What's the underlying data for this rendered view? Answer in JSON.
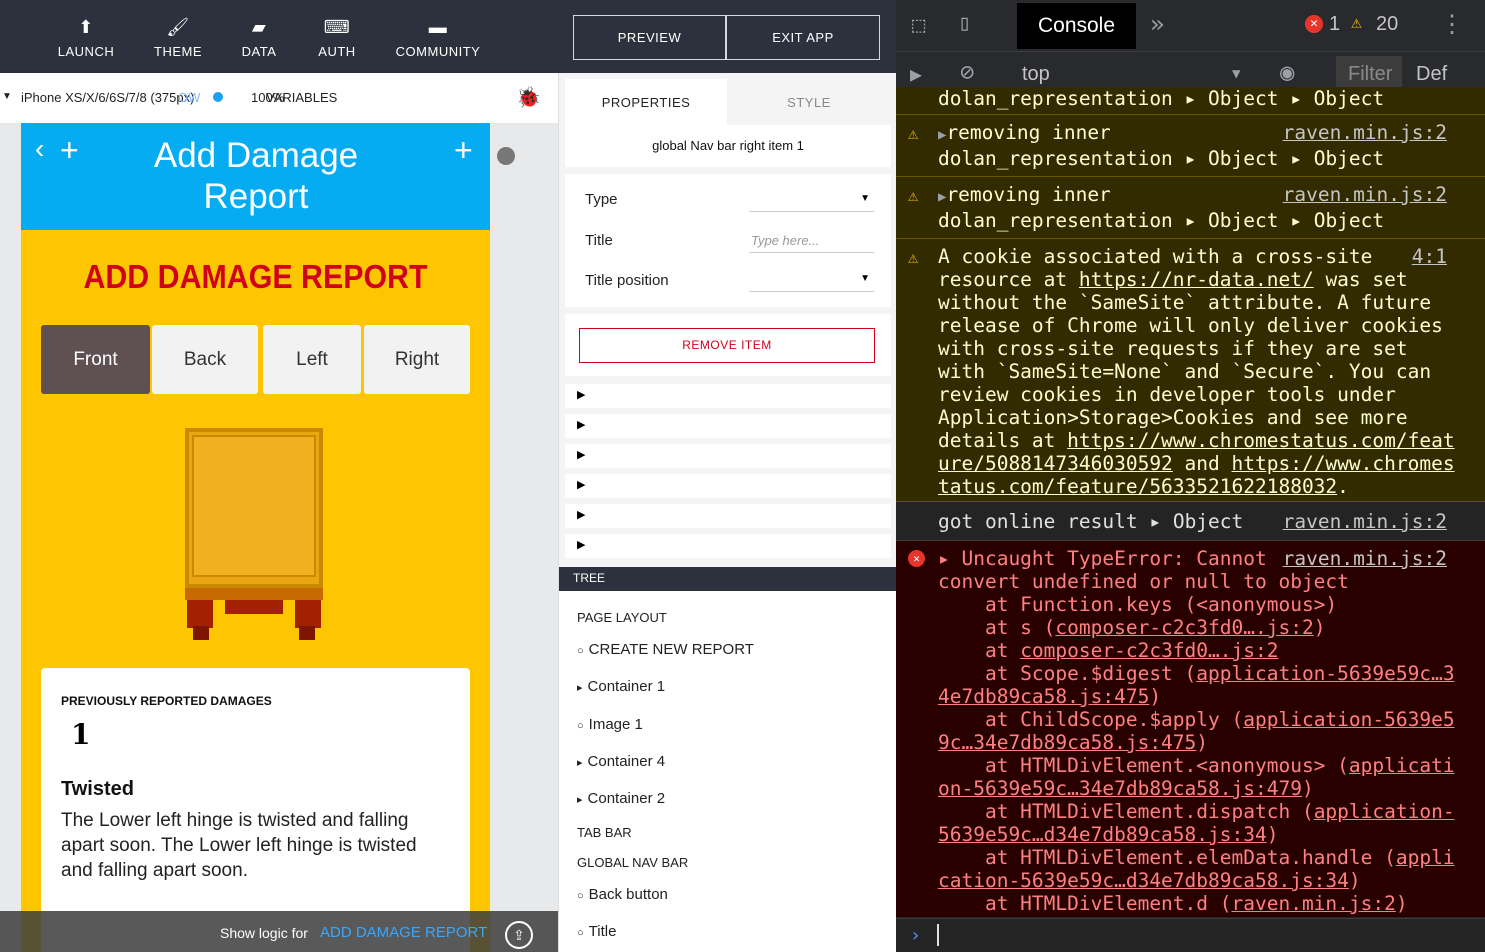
{
  "topnav": {
    "items": [
      {
        "icon": "upload-icon",
        "label": "LAUNCH"
      },
      {
        "icon": "brush-icon",
        "label": "THEME"
      },
      {
        "icon": "folder-icon",
        "label": "DATA"
      },
      {
        "icon": "code-file-icon",
        "label": "AUTH"
      },
      {
        "icon": "chat-icon",
        "label": "COMMUNITY"
      }
    ],
    "preview": "PREVIEW",
    "exit": "EXIT APP"
  },
  "devbar": {
    "device": "iPhone XS/X/6/6S/7/8 (375px)",
    "zoom": "100%",
    "zoom_overlap": "OW",
    "variables": "VARIABLES"
  },
  "phone": {
    "nav_title": "Add Damage Report",
    "heading": "ADD DAMAGE REPORT",
    "buttons": [
      "Front",
      "Back",
      "Left",
      "Right"
    ],
    "card": {
      "label": "PREVIOUSLY REPORTED DAMAGES",
      "count": "1",
      "damage_title": "Twisted",
      "damage_text": "The Lower left hinge is twisted and falling apart soon. The Lower left hinge is twisted and falling apart soon."
    }
  },
  "logic": {
    "prefix": "Show logic for",
    "screen": "ADD DAMAGE REPORT"
  },
  "panel": {
    "tabs": [
      "PROPERTIES",
      "STYLE"
    ],
    "selected": "global Nav bar right item 1",
    "type_label": "Type",
    "title_label": "Title",
    "title_placeholder": "Type here...",
    "title_position_label": "Title position",
    "remove": "REMOVE ITEM",
    "tree_header": "TREE",
    "tree": {
      "page_layout": "PAGE LAYOUT",
      "items": [
        {
          "label": "CREATE NEW REPORT",
          "marker": "○"
        },
        {
          "label": "Container 1",
          "marker": "▸"
        },
        {
          "label": "Image 1",
          "marker": "○"
        },
        {
          "label": "Container 4",
          "marker": "▸"
        },
        {
          "label": "Container 2",
          "marker": "▸"
        }
      ],
      "tab_bar": "TAB BAR",
      "global_nav": "GLOBAL NAV BAR",
      "nav_items": [
        {
          "label": "Back button",
          "marker": "○"
        },
        {
          "label": "Title",
          "marker": "○"
        }
      ]
    }
  },
  "devtools": {
    "tab": "Console",
    "error_count": "1",
    "warn_count": "20",
    "context": "top",
    "filter": "Filter",
    "default_levels": "Def",
    "logs": [
      {
        "text": "dolan_representation ▸ Object ▸ Object"
      },
      {
        "line1": "removing inner",
        "line2": "dolan_representation",
        "objs": "▸ Object  ▸ Object",
        "src": "raven.min.js:2"
      },
      {
        "line1": "removing inner",
        "line2": "dolan_representation",
        "objs": "▸ Object  ▸ Object",
        "src": "raven.min.js:2"
      },
      {
        "text1": "A cookie associated with a cross-site",
        "text2": "resource at",
        "link1": "https://nr-data.net/",
        "text3": " was set",
        "text4": "without the `SameSite` attribute. A future",
        "text5": "release of Chrome will only deliver cookies",
        "text6": "with cross-site requests if they are set",
        "text7": "with `SameSite=None` and `Secure`. You can",
        "text8": "review cookies in developer tools under",
        "text9": "Application>Storage>Cookies and see more",
        "text10": "details at ",
        "link2a": "https://www.chromestatus.com/feat",
        "link2b": "ure/5088147346030592",
        "and": " and ",
        "link3a": "https://www.chromes",
        "link3b": "tatus.com/feature/5633521622188032",
        "dot": ".",
        "src": "4:1"
      },
      {
        "text": "got online result",
        "obj": "▸ Object",
        "src": "raven.min.js:2"
      }
    ],
    "error": {
      "line1": "▸ Uncaught TypeError: Cannot",
      "line2": "convert undefined or null to object",
      "src": "raven.min.js:2",
      "stack": [
        {
          "pre": "    at Function.keys (<anonymous>)",
          "link": "",
          "post": ""
        },
        {
          "pre": "    at s (",
          "link": "composer-c2c3fd0….js:2",
          "post": ")"
        },
        {
          "pre": "    at ",
          "link": "composer-c2c3fd0….js:2",
          "post": ""
        },
        {
          "pre": "    at Scope.$digest (",
          "link": "application-5639e59c…3",
          "post": ""
        },
        {
          "pre": "",
          "link": "4e7db89ca58.js:475",
          "post": ")"
        },
        {
          "pre": "    at ChildScope.$apply (",
          "link": "application-5639e5",
          "post": ""
        },
        {
          "pre": "",
          "link": "9c…34e7db89ca58.js:475",
          "post": ")"
        },
        {
          "pre": "    at HTMLDivElement.<anonymous> (",
          "link": "applicati",
          "post": ""
        },
        {
          "pre": "",
          "link": "on-5639e59c…34e7db89ca58.js:479",
          "post": ")"
        },
        {
          "pre": "    at HTMLDivElement.dispatch (",
          "link": "application-",
          "post": ""
        },
        {
          "pre": "",
          "link": "5639e59c…d34e7db89ca58.js:34",
          "post": ")"
        },
        {
          "pre": "    at HTMLDivElement.elemData.handle (",
          "link": "appli",
          "post": ""
        },
        {
          "pre": "",
          "link": "cation-5639e59c…d34e7db89ca58.js:34",
          "post": ")"
        },
        {
          "pre": "    at HTMLDivElement.d (",
          "link": "raven.min.js:2",
          "post": ")"
        }
      ]
    }
  }
}
